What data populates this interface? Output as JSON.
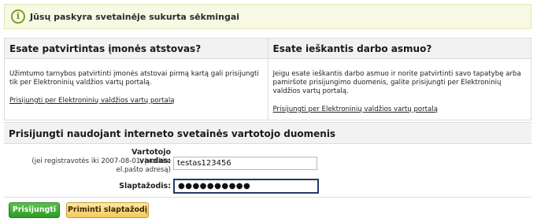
{
  "notice": {
    "icon": "info-icon",
    "text": "Jūsų paskyra svetainėje sukurta sėkmingai"
  },
  "panel_left": {
    "title": "Esate patvirtintas įmonės atstovas?",
    "body": "Užimtumo tarnybos patvirtinti įmonės atstovai pirmą kartą gali prisijungti tik per Elektroninių valdžios vartų portalą.",
    "link": "Prisijungti per Elektroninių valdžios vartų portalą"
  },
  "panel_right": {
    "title": "Esate ieškantis darbo asmuo?",
    "body": "Jeigu esate ieškantis darbo asmuo ir norite patvirtinti savo tapatybę arba pamiršote prisijungimo duomenis, galite prisijungti per Elektroninių valdžios vartų portalą.",
    "link": "Prisijungti per Elektroninių valdžios vartų portalą"
  },
  "login": {
    "title": "Prisijungti naudojant interneto svetainės vartotojo duomenis",
    "username_label": "Vartotojo vardas:",
    "username_hint": "(jei registravotės iki 2007-08-01, įveskite el.pašto adresą)",
    "username_value": "testas123456",
    "password_label": "Slaptažodis:",
    "password_value": "●●●●●●●●●●"
  },
  "buttons": {
    "login": "Prisijungti",
    "remind": "Priminti slaptažodį"
  },
  "colors": {
    "notice_bg": "#f7f9e2",
    "login_button": "#3aa832",
    "remind_button": "#f5c85f"
  }
}
